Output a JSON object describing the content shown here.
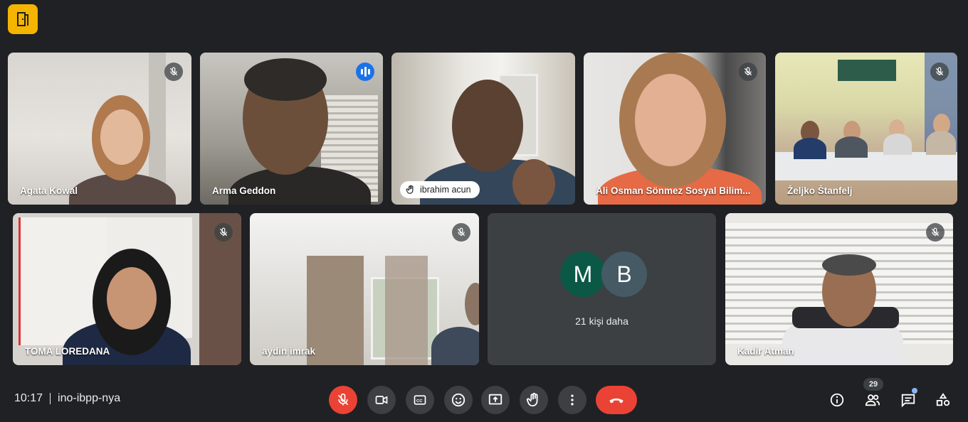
{
  "app": {
    "logo_icon": "door-exit-icon",
    "brand_color": "#f4b400"
  },
  "participants": [
    {
      "name": "Agata Kowal",
      "muted": true
    },
    {
      "name": "Arma Geddon",
      "speaking": true
    },
    {
      "name": "ibrahim acun",
      "hand_raised": true
    },
    {
      "name": "Ali Osman Sönmez Sosyal Bilim...",
      "muted": true
    },
    {
      "name": "Željko Štanfelj",
      "muted": true
    },
    {
      "name": "TOMA LOREDANA",
      "muted": true
    },
    {
      "name": "aydin imrak",
      "muted": true
    },
    {
      "name": "Kadir Atman",
      "muted": true
    }
  ],
  "others_tile": {
    "avatars": [
      {
        "initial": "M",
        "color": "#0b5846"
      },
      {
        "initial": "B",
        "color": "#455a64"
      }
    ],
    "label": "21 kişi daha"
  },
  "footer": {
    "time": "10:17",
    "meeting_code": "ino-ibpp-nya",
    "controls": [
      {
        "name": "microphone-off",
        "icon": "mic-off-icon",
        "active_color": "#ea4335"
      },
      {
        "name": "camera",
        "icon": "video-camera-icon"
      },
      {
        "name": "captions",
        "icon": "closed-captions-icon"
      },
      {
        "name": "reactions",
        "icon": "emoji-icon"
      },
      {
        "name": "present",
        "icon": "present-screen-icon"
      },
      {
        "name": "raise-hand",
        "icon": "hand-icon"
      },
      {
        "name": "more-options",
        "icon": "more-vert-icon"
      },
      {
        "name": "leave-call",
        "icon": "phone-hangup-icon"
      }
    ],
    "right": {
      "info_icon": "info-icon",
      "people_icon": "people-icon",
      "people_count": "29",
      "chat_icon": "chat-icon",
      "activities_icon": "activities-icon"
    }
  }
}
